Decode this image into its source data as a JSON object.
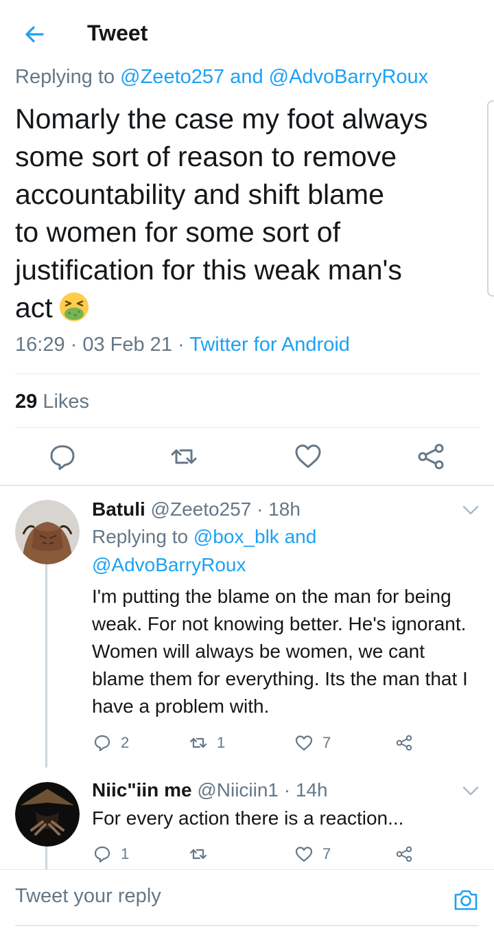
{
  "header": {
    "title": "Tweet"
  },
  "tweet": {
    "replying_prefix": "Replying to ",
    "replying_handles": "@Zeeto257 and @AdvoBarryRoux",
    "text": "Nomarly the case my foot always\nsome sort of reason to remove\naccountability and shift blame\nto women for some sort of\njustification for this weak man's\nact",
    "emoji": "nauseated-face-emoji",
    "time": "16:29 · 03 Feb 21 · ",
    "source": "Twitter for Android",
    "likes_count": "29",
    "likes_label": " Likes"
  },
  "replies": [
    {
      "name": "Batuli",
      "handle": " @Zeeto257 · 18h",
      "replying_prefix": "Replying to ",
      "replying_line1": "@box_blk and",
      "replying_line2": "@AdvoBarryRoux",
      "text": "I'm putting the blame on the man for being weak. For not knowing better. He's ignorant. Women will always be women, we cant blame them for everything. Its the man that I have a problem with.",
      "reply_count": "2",
      "retweet_count": "1",
      "like_count": "7"
    },
    {
      "name": "Niic\"iin me",
      "handle": " @Niiciin1 · 14h",
      "text": "For every action there is a reaction...",
      "reply_count": "1",
      "retweet_count": "",
      "like_count": "7"
    }
  ],
  "compose": {
    "placeholder": "Tweet your reply"
  },
  "colors": {
    "accent": "#1da1f2",
    "muted": "#657786",
    "divider": "#e1e8ed"
  }
}
